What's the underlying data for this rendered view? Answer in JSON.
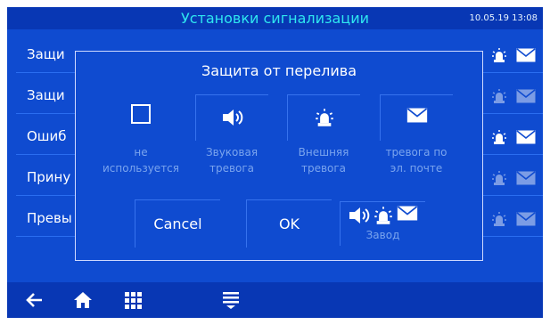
{
  "header": {
    "title": "Установки сигнализации",
    "datetime": "10.05.19 13:08"
  },
  "list": {
    "rows": [
      {
        "label": "Защи"
      },
      {
        "label": "Защи"
      },
      {
        "label": "Ошиб"
      },
      {
        "label": "Прину"
      },
      {
        "label": "Превы"
      }
    ]
  },
  "dialog": {
    "title": "Защита от перелива",
    "options": [
      {
        "id": "none",
        "label_line1": "не",
        "label_line2": "используется",
        "icon": "checkbox-empty"
      },
      {
        "id": "sound",
        "label_line1": "Звуковая",
        "label_line2": "тревога",
        "icon": "speaker-icon"
      },
      {
        "id": "external",
        "label_line1": "Внешняя",
        "label_line2": "тревога",
        "icon": "beacon-icon"
      },
      {
        "id": "email",
        "label_line1": "тревога по",
        "label_line2": "эл. почте",
        "icon": "envelope-icon"
      }
    ],
    "buttons": {
      "cancel": "Cancel",
      "ok": "OK"
    },
    "preset": {
      "label": "Завод"
    }
  },
  "colors": {
    "background": "#0f4bd0",
    "bar": "#0837b4",
    "title": "#2ee6f0",
    "inactive_text": "#7aa4ee"
  },
  "bottom_nav": [
    "back-arrow-icon",
    "home-icon",
    "grid-menu-icon",
    "list-menu-icon"
  ]
}
